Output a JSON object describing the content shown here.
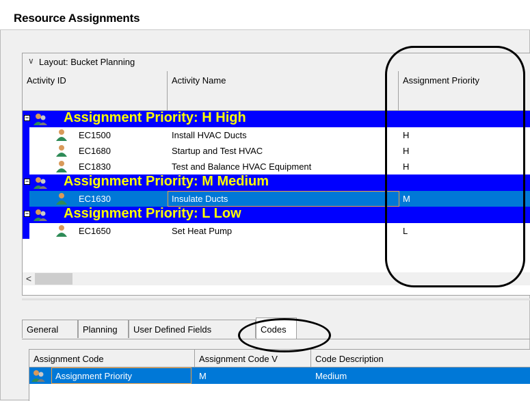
{
  "window": {
    "title": "Resource Assignments"
  },
  "layout": {
    "label": "Layout: Bucket Planning"
  },
  "columns": [
    "Activity ID",
    "Activity Name",
    "Assignment Priority"
  ],
  "groups": [
    {
      "label": "Assignment Priority: H  High",
      "rows": [
        {
          "id": "EC1500",
          "name": "Install HVAC Ducts",
          "priority": "H"
        },
        {
          "id": "EC1680",
          "name": "Startup and Test HVAC",
          "priority": "H"
        },
        {
          "id": "EC1830",
          "name": "Test and Balance HVAC Equipment",
          "priority": "H"
        }
      ]
    },
    {
      "label": "Assignment Priority: M  Medium",
      "rows": [
        {
          "id": "EC1630",
          "name": "Insulate Ducts",
          "priority": "M"
        }
      ]
    },
    {
      "label": "Assignment Priority: L  Low",
      "rows": [
        {
          "id": "EC1650",
          "name": "Set Heat Pump",
          "priority": "L"
        }
      ]
    }
  ],
  "hscroll": {
    "left_arrow": "<"
  },
  "tabs": [
    "General",
    "Planning",
    "User Defined Fields",
    "Codes"
  ],
  "active_tab": "Codes",
  "codes_table": {
    "columns": [
      "Assignment Code",
      "Assignment Code V",
      "Code Description"
    ],
    "rows": [
      {
        "code": "Assignment Priority",
        "value": "M",
        "description": "Medium"
      }
    ]
  },
  "colors": {
    "group_band": "#0000ff",
    "group_text": "#ffff00",
    "selection": "#0078d7",
    "focus_outline": "#f0a040"
  },
  "icons": {
    "group": "resource-group-icon",
    "row": "resource-person-icon",
    "expander": "collapse-minus-icon"
  }
}
